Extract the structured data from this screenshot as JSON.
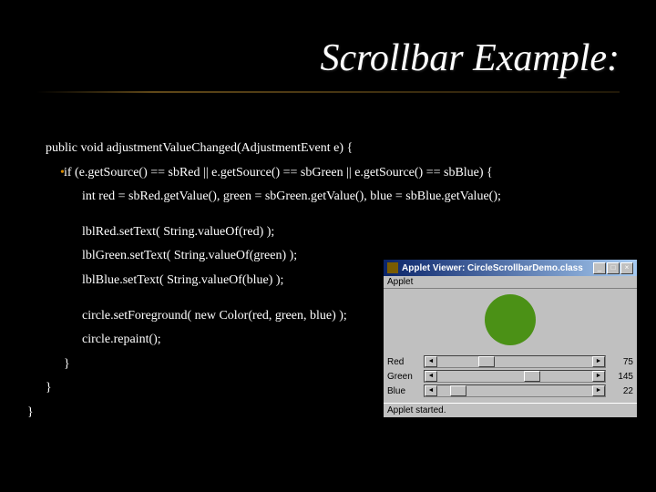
{
  "title": "Scrollbar Example:",
  "code": {
    "l0": "public void adjustmentValueChanged(AdjustmentEvent e) {",
    "l1": "if (e.getSource() == sbRed || e.getSource() == sbGreen || e.getSource() == sbBlue) {",
    "l2": "int red = sbRed.getValue(), green = sbGreen.getValue(), blue = sbBlue.getValue();",
    "l3": "lblRed.setText( String.valueOf(red) );",
    "l4": "lblGreen.setText( String.valueOf(green) );",
    "l5": "lblBlue.setText( String.valueOf(blue) );",
    "l6": "circle.setForeground( new Color(red, green, blue) );",
    "l7": "circle.repaint();",
    "l8": "}",
    "l9": "}",
    "l10": "}"
  },
  "applet": {
    "title": "Applet Viewer: CircleScrollbarDemo.class",
    "menu": "Applet",
    "status": "Applet started.",
    "rows": {
      "red": {
        "label": "Red",
        "value": "75",
        "thumb_left": "30%"
      },
      "green": {
        "label": "Green",
        "value": "145",
        "thumb_left": "55%"
      },
      "blue": {
        "label": "Blue",
        "value": "22",
        "thumb_left": "14%"
      }
    },
    "circle_color": "#4b9116"
  }
}
